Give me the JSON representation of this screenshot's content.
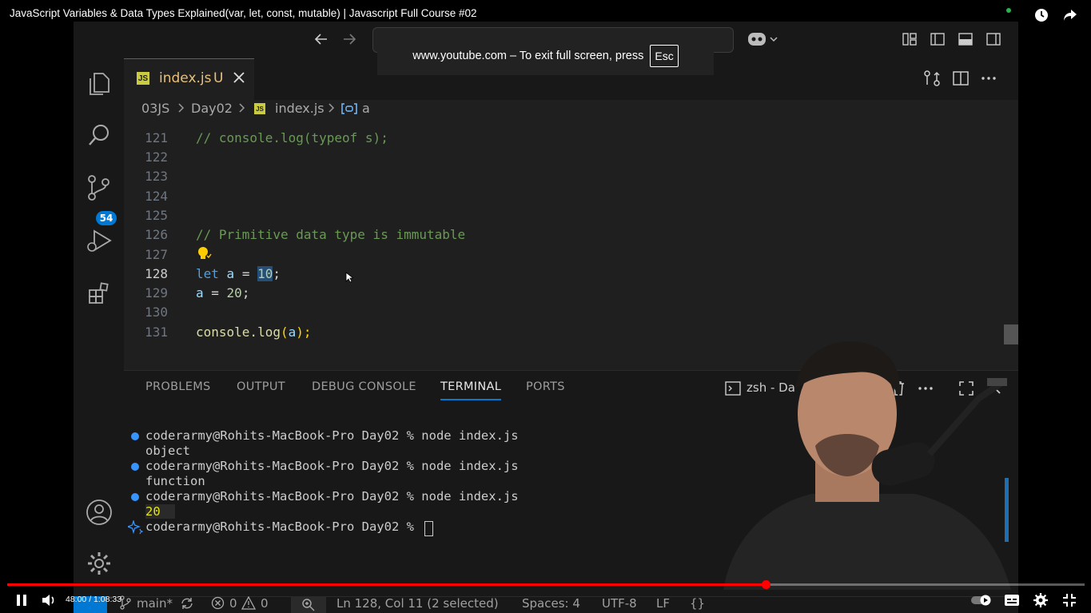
{
  "youtube": {
    "title": "JavaScript Variables & Data Types Explained(var, let, const, mutable) | Javascript Full Course #02",
    "time": "48:00 / 1:08:33",
    "progress_fraction": 0.704,
    "fullscreen_msg": "www.youtube.com – To exit full screen, press",
    "esc_key": "Esc"
  },
  "vscode": {
    "source_control_badge": "54",
    "tab": {
      "name": "index.js",
      "status": "U"
    },
    "breadcrumb": {
      "folder1": "03JS",
      "folder2": "Day02",
      "file": "index.js",
      "symbol": "a"
    },
    "lines": {
      "n121": "121",
      "n122": "122",
      "n123": "123",
      "n124": "124",
      "n125": "125",
      "n126": "126",
      "n127": "127",
      "n128": "128",
      "n129": "129",
      "n130": "130",
      "n131": "131"
    },
    "code": {
      "l121": "// console.log(typeof s);",
      "l126": "// Primitive data type is immutable",
      "l128_kw": "let",
      "l128_var": "a",
      "l128_eq": " = ",
      "l128_num": "10",
      "l128_end": ";",
      "l129_var": "a",
      "l129_eq": " = ",
      "l129_num": "20",
      "l129_end": ";",
      "l131_fn": "console.log",
      "l131_p1": "(",
      "l131_var": "a",
      "l131_p2": ");"
    },
    "panel_tabs": {
      "problems": "PROBLEMS",
      "output": "OUTPUT",
      "debug": "DEBUG CONSOLE",
      "terminal": "TERMINAL",
      "ports": "PORTS"
    },
    "terminal_name": "zsh - Da",
    "terminal": {
      "p1": "coderarmy@Rohits-MacBook-Pro Day02 % node index.js",
      "o1": "object",
      "p2": "coderarmy@Rohits-MacBook-Pro Day02 % node index.js",
      "o2": "function",
      "p3": "coderarmy@Rohits-MacBook-Pro Day02 % node index.js",
      "o3": "20",
      "p4": "coderarmy@Rohits-MacBook-Pro Day02 % "
    },
    "status": {
      "branch": "main*",
      "errors": "0",
      "warnings": "0",
      "position": "Ln 128, Col 11 (2 selected)",
      "spaces": "Spaces: 4",
      "encoding": "UTF-8",
      "eol": "LF",
      "lang": "{}"
    }
  }
}
